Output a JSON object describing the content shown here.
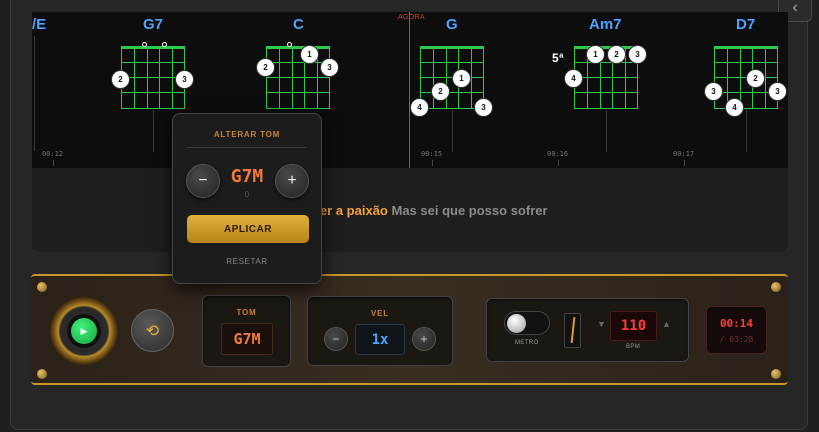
{
  "timeline": {
    "now_label": "AGORA",
    "chords": [
      {
        "name": "/E"
      },
      {
        "name": "G7"
      },
      {
        "name": "C"
      },
      {
        "name": "G"
      },
      {
        "name": "Am7"
      },
      {
        "name": "D7"
      }
    ],
    "fret_marker": "5ª",
    "times": [
      "00:12",
      "00:15",
      "00:16",
      "00:17"
    ]
  },
  "lyric": {
    "highlight": "der a paixão",
    "rest": " Mas sei que posso sofrer"
  },
  "transpose_popup": {
    "title": "ALTERAR TOM",
    "minus_label": "−",
    "plus_label": "+",
    "key": "G7M",
    "offset": "0",
    "apply_label": "APLICAR",
    "reset_label": "RESETAR"
  },
  "controls": {
    "tom_label": "TOM",
    "tom_value": "G7M",
    "vel_label": "VEL",
    "vel_value": "1x",
    "vel_minus": "−",
    "vel_plus": "+",
    "metro_label": "METRO",
    "bpm_value": "110",
    "bpm_label": "BPM",
    "time_current": "00:14",
    "time_total": "/ 03:28"
  },
  "colors": {
    "chord_name": "#4da3ff",
    "fretboard": "#2ec84a",
    "accent_orange": "#f07a3a",
    "gold": "#c9962e",
    "playhead": "#d43c3c"
  }
}
